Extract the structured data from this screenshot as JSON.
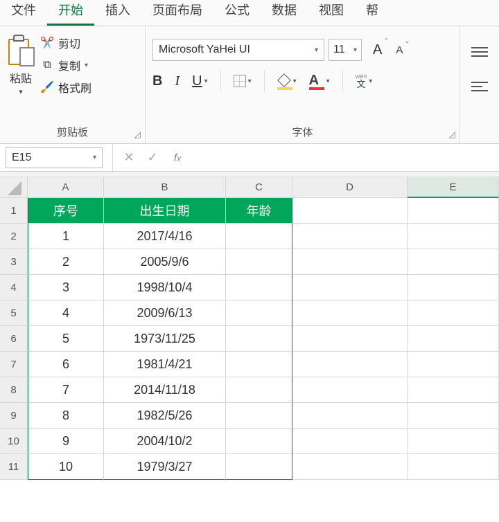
{
  "menu": {
    "file": "文件",
    "home": "开始",
    "insert": "插入",
    "pagelayout": "页面布局",
    "formulas": "公式",
    "data": "数据",
    "view": "视图",
    "help": "帮"
  },
  "ribbon": {
    "clipboard": {
      "paste": "粘贴",
      "cut": "剪切",
      "copy": "复制",
      "format_painter": "格式刷",
      "group": "剪贴板"
    },
    "font": {
      "name": "Microsoft YaHei UI",
      "size": "11",
      "bold": "B",
      "italic": "I",
      "underline": "U",
      "wen_pin": "wén",
      "wen": "文",
      "group": "字体"
    }
  },
  "namebox": "E15",
  "formula": "",
  "columns": [
    "A",
    "B",
    "C",
    "D",
    "E"
  ],
  "rows": [
    "1",
    "2",
    "3",
    "4",
    "5",
    "6",
    "7",
    "8",
    "9",
    "10",
    "11"
  ],
  "headers": {
    "A": "序号",
    "B": "出生日期",
    "C": "年龄"
  },
  "tabledata": [
    {
      "n": "1",
      "d": "2017/4/16",
      "a": ""
    },
    {
      "n": "2",
      "d": "2005/9/6",
      "a": ""
    },
    {
      "n": "3",
      "d": "1998/10/4",
      "a": ""
    },
    {
      "n": "4",
      "d": "2009/6/13",
      "a": ""
    },
    {
      "n": "5",
      "d": "1973/11/25",
      "a": ""
    },
    {
      "n": "6",
      "d": "1981/4/21",
      "a": ""
    },
    {
      "n": "7",
      "d": "2014/11/18",
      "a": ""
    },
    {
      "n": "8",
      "d": "1982/5/26",
      "a": ""
    },
    {
      "n": "9",
      "d": "2004/10/2",
      "a": ""
    },
    {
      "n": "10",
      "d": "1979/3/27",
      "a": ""
    }
  ]
}
